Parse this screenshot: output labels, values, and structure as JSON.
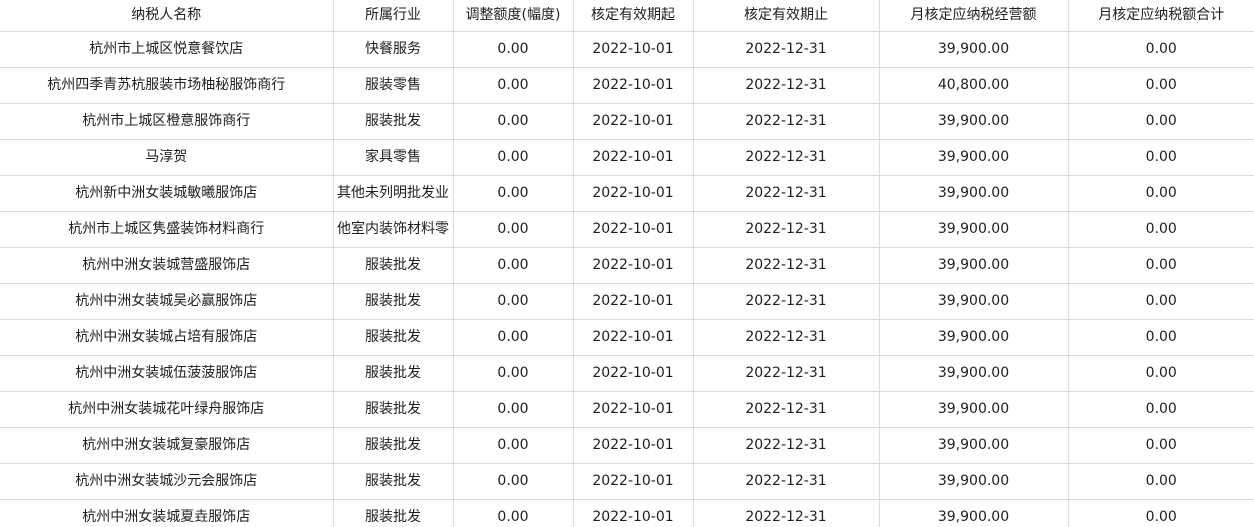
{
  "table": {
    "headers": [
      "纳税人名称",
      "所属行业",
      "调整额度(幅度)",
      "核定有效期起",
      "核定有效期止",
      "月核定应纳税经营额",
      "月核定应纳税额合计"
    ],
    "rows": [
      [
        "杭州市上城区悦意餐饮店",
        "快餐服务",
        "0.00",
        "2022-10-01",
        "2022-12-31",
        "39,900.00",
        "0.00"
      ],
      [
        "杭州四季青苏杭服装市场柚秘服饰商行",
        "服装零售",
        "0.00",
        "2022-10-01",
        "2022-12-31",
        "40,800.00",
        "0.00"
      ],
      [
        "杭州市上城区橙意服饰商行",
        "服装批发",
        "0.00",
        "2022-10-01",
        "2022-12-31",
        "39,900.00",
        "0.00"
      ],
      [
        "马淳贺",
        "家具零售",
        "0.00",
        "2022-10-01",
        "2022-12-31",
        "39,900.00",
        "0.00"
      ],
      [
        "杭州新中洲女装城敏曦服饰店",
        "其他未列明批发业",
        "0.00",
        "2022-10-01",
        "2022-12-31",
        "39,900.00",
        "0.00"
      ],
      [
        "杭州市上城区隽盛装饰材料商行",
        "他室内装饰材料零",
        "0.00",
        "2022-10-01",
        "2022-12-31",
        "39,900.00",
        "0.00"
      ],
      [
        "杭州中洲女装城营盛服饰店",
        "服装批发",
        "0.00",
        "2022-10-01",
        "2022-12-31",
        "39,900.00",
        "0.00"
      ],
      [
        "杭州中洲女装城吴必赢服饰店",
        "服装批发",
        "0.00",
        "2022-10-01",
        "2022-12-31",
        "39,900.00",
        "0.00"
      ],
      [
        "杭州中洲女装城占培有服饰店",
        "服装批发",
        "0.00",
        "2022-10-01",
        "2022-12-31",
        "39,900.00",
        "0.00"
      ],
      [
        "杭州中洲女装城伍菠菠服饰店",
        "服装批发",
        "0.00",
        "2022-10-01",
        "2022-12-31",
        "39,900.00",
        "0.00"
      ],
      [
        "杭州中洲女装城花叶绿舟服饰店",
        "服装批发",
        "0.00",
        "2022-10-01",
        "2022-12-31",
        "39,900.00",
        "0.00"
      ],
      [
        "杭州中洲女装城复豪服饰店",
        "服装批发",
        "0.00",
        "2022-10-01",
        "2022-12-31",
        "39,900.00",
        "0.00"
      ],
      [
        "杭州中洲女装城沙元会服饰店",
        "服装批发",
        "0.00",
        "2022-10-01",
        "2022-12-31",
        "39,900.00",
        "0.00"
      ],
      [
        "杭州中洲女装城夏垚服饰店",
        "服装批发",
        "0.00",
        "2022-10-01",
        "2022-12-31",
        "39,900.00",
        "0.00"
      ]
    ]
  },
  "colors": {
    "grid_line": "#dcdcdc",
    "text": "#1f1f1f",
    "background": "#ffffff"
  }
}
